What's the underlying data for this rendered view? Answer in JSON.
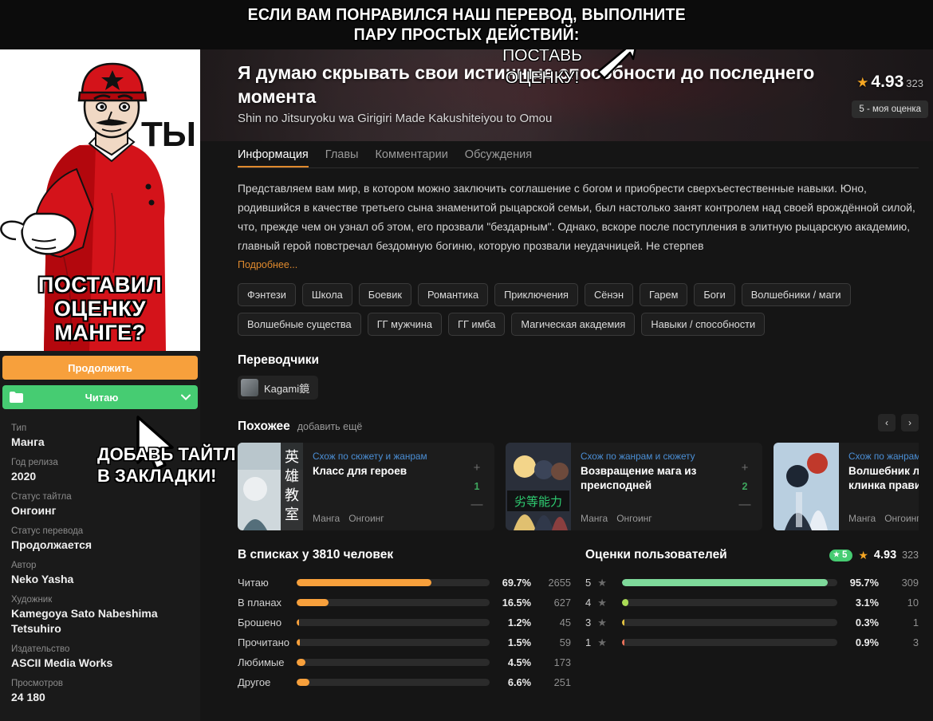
{
  "banner": {
    "line1": "ЕСЛИ ВАМ ПОНРАВИЛСЯ НАШ ПЕРЕВОД, ВЫПОЛНИТЕ",
    "line2": "ПАРУ ПРОСТЫХ ДЕЙСТВИЙ:"
  },
  "meme": {
    "you": "ТЫ",
    "line1": "ПОСТАВИЛ",
    "line2": "ОЦЕНКУ",
    "line3": "МАНГЕ?"
  },
  "overlays": {
    "rate_cta_line1": "ПОСТАВЬ",
    "rate_cta_line2": "ОЦЕНКУ!",
    "bookmark_cta_line1": "ДОБАВЬ ТАЙТЛ",
    "bookmark_cta_line2": "В ЗАКЛАДКИ!"
  },
  "sidebar": {
    "continue_label": "Продолжить",
    "bookmark_label": "Читаю",
    "bookmark_icon": "folder-icon",
    "chevron_icon": "chevron-down-icon",
    "info": [
      {
        "label": "Тип",
        "value": "Манга"
      },
      {
        "label": "Год релиза",
        "value": "2020"
      },
      {
        "label": "Статус тайтла",
        "value": "Онгоинг"
      },
      {
        "label": "Статус перевода",
        "value": "Продолжается"
      },
      {
        "label": "Автор",
        "value": "Neko Yasha"
      },
      {
        "label": "Художник",
        "value": "Kamegoya Sato  Nabeshima Tetsuhiro"
      },
      {
        "label": "Издательство",
        "value": "ASCII Media Works"
      },
      {
        "label": "Просмотров",
        "value": "24 180"
      }
    ]
  },
  "hero": {
    "title": "Я думаю скрывать свои истинные способности до последнего момента",
    "subtitle": "Shin no Jitsuryoku wa Girigiri Made Kakushiteiyou to Omou",
    "rating_star_icon": "star-icon",
    "rating_value": "4.93",
    "rating_count": "323",
    "my_rating_chip": "5 - моя оценка"
  },
  "tabs": [
    {
      "label": "Информация",
      "active": true
    },
    {
      "label": "Главы",
      "active": false
    },
    {
      "label": "Комментарии",
      "active": false
    },
    {
      "label": "Обсуждения",
      "active": false
    }
  ],
  "description": {
    "text": "Представляем вам мир, в котором можно заключить соглашение с богом и приобрести сверхъестественные навыки. Юно, родившийся в качестве третьего сына знаменитой рыцарской семьи, был настолько занят контролем над своей врождённой силой, что, прежде чем он узнал об этом, его прозвали \"бездарным\". Однако, вскоре после поступления в элитную рыцарскую академию, главный герой повстречал бездомную богиню, которую прозвали неудачницей. Не стерпев",
    "more_label": "Подробнее..."
  },
  "genres": [
    "Фэнтези",
    "Школа",
    "Боевик",
    "Романтика",
    "Приключения",
    "Сёнэн",
    "Гарем",
    "Боги",
    "Волшебники / маги",
    "Волшебные существа",
    "ГГ мужчина",
    "ГГ имба",
    "Магическая академия",
    "Навыки / способности"
  ],
  "translators": {
    "title": "Переводчики",
    "items": [
      {
        "name": "Kagami鏡"
      }
    ]
  },
  "similar": {
    "title": "Похожее",
    "add_label": "добавить ещё",
    "prev_icon": "chevron-left-icon",
    "next_icon": "chevron-right-icon",
    "cards": [
      {
        "kind": "Схож по сюжету и жанрам",
        "name": "Класс для героев",
        "type": "Манга",
        "status": "Онгоинг",
        "votes": "1",
        "plus": "+",
        "minus": "—"
      },
      {
        "kind": "Схож по жанрам и сюжету",
        "name": "Возвращение мага из преисподней",
        "type": "Манга",
        "status": "Онгоинг",
        "votes": "2",
        "plus": "+",
        "minus": "—"
      },
      {
        "kind": "Схож по жанрам",
        "name": "Волшебник ледяного клинка правит миром",
        "type": "Манга",
        "status": "Онгоинг",
        "votes": "",
        "plus": "+",
        "minus": "—"
      }
    ]
  },
  "chart_data": [
    {
      "type": "bar",
      "title": "В списках у 3810 человек",
      "orientation": "horizontal",
      "categories": [
        "Читаю",
        "В планах",
        "Брошено",
        "Прочитано",
        "Любимые",
        "Другое"
      ],
      "values": [
        69.7,
        16.5,
        1.2,
        1.5,
        4.5,
        6.6
      ],
      "value_labels": [
        "69.7%",
        "16.5%",
        "1.2%",
        "1.5%",
        "4.5%",
        "6.6%"
      ],
      "counts": [
        2655,
        627,
        45,
        59,
        173,
        251
      ],
      "count_labels": [
        "2655",
        "627",
        "45",
        "59",
        "173",
        "251"
      ],
      "color": "#f7a03c",
      "track_color": "#2b2b2b",
      "xlim": [
        0,
        100
      ],
      "ylabel": "",
      "xlabel": "",
      "grid": false,
      "legend": false
    },
    {
      "type": "bar",
      "title": "Оценки пользователей",
      "orientation": "horizontal",
      "categories": [
        "5",
        "4",
        "3",
        "1"
      ],
      "values": [
        95.7,
        3.1,
        0.3,
        0.9
      ],
      "value_labels": [
        "95.7%",
        "3.1%",
        "0.3%",
        "0.9%"
      ],
      "counts": [
        309,
        10,
        1,
        3
      ],
      "count_labels": [
        "309",
        "10",
        "1",
        "3"
      ],
      "bar_colors": [
        "#7ed99a",
        "#aadb55",
        "#e0c040",
        "#e8705a"
      ],
      "track_color": "#2b2b2b",
      "xlim": [
        0,
        100
      ],
      "my_score_chip": "5",
      "avg_value": "4.93",
      "avg_count": "323",
      "grid": false,
      "legend": false
    }
  ],
  "colors": {
    "accent_orange": "#f7a03c",
    "accent_green": "#46cc72",
    "link_blue": "#4b8fd6",
    "bg": "#151515"
  }
}
